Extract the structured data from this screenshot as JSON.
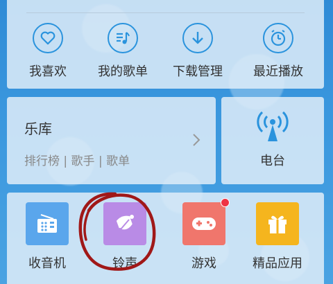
{
  "quick_actions": [
    {
      "label": "我喜欢",
      "icon": "heart-icon"
    },
    {
      "label": "我的歌单",
      "icon": "playlist-icon"
    },
    {
      "label": "下载管理",
      "icon": "download-icon"
    },
    {
      "label": "最近播放",
      "icon": "clock-icon"
    }
  ],
  "library": {
    "title": "乐库",
    "subtitle": "排行榜 | 歌手 | 歌单",
    "arrow_icon": "chevron-right-icon"
  },
  "radio": {
    "label": "电台",
    "icon": "radio-tower-icon"
  },
  "apps": [
    {
      "label": "收音机",
      "icon": "radio-receiver-icon",
      "color": "#5aa6ec"
    },
    {
      "label": "铃声",
      "icon": "ringtone-bell-icon",
      "color": "#b98be6"
    },
    {
      "label": "游戏",
      "icon": "gamepad-icon",
      "color": "#f0766c",
      "badge": true
    },
    {
      "label": "精品应用",
      "icon": "gift-icon",
      "color": "#f5b51e"
    }
  ],
  "colors": {
    "accent": "#2a93dd",
    "badge": "#ee3344",
    "annotation_circle": "#a01818"
  }
}
